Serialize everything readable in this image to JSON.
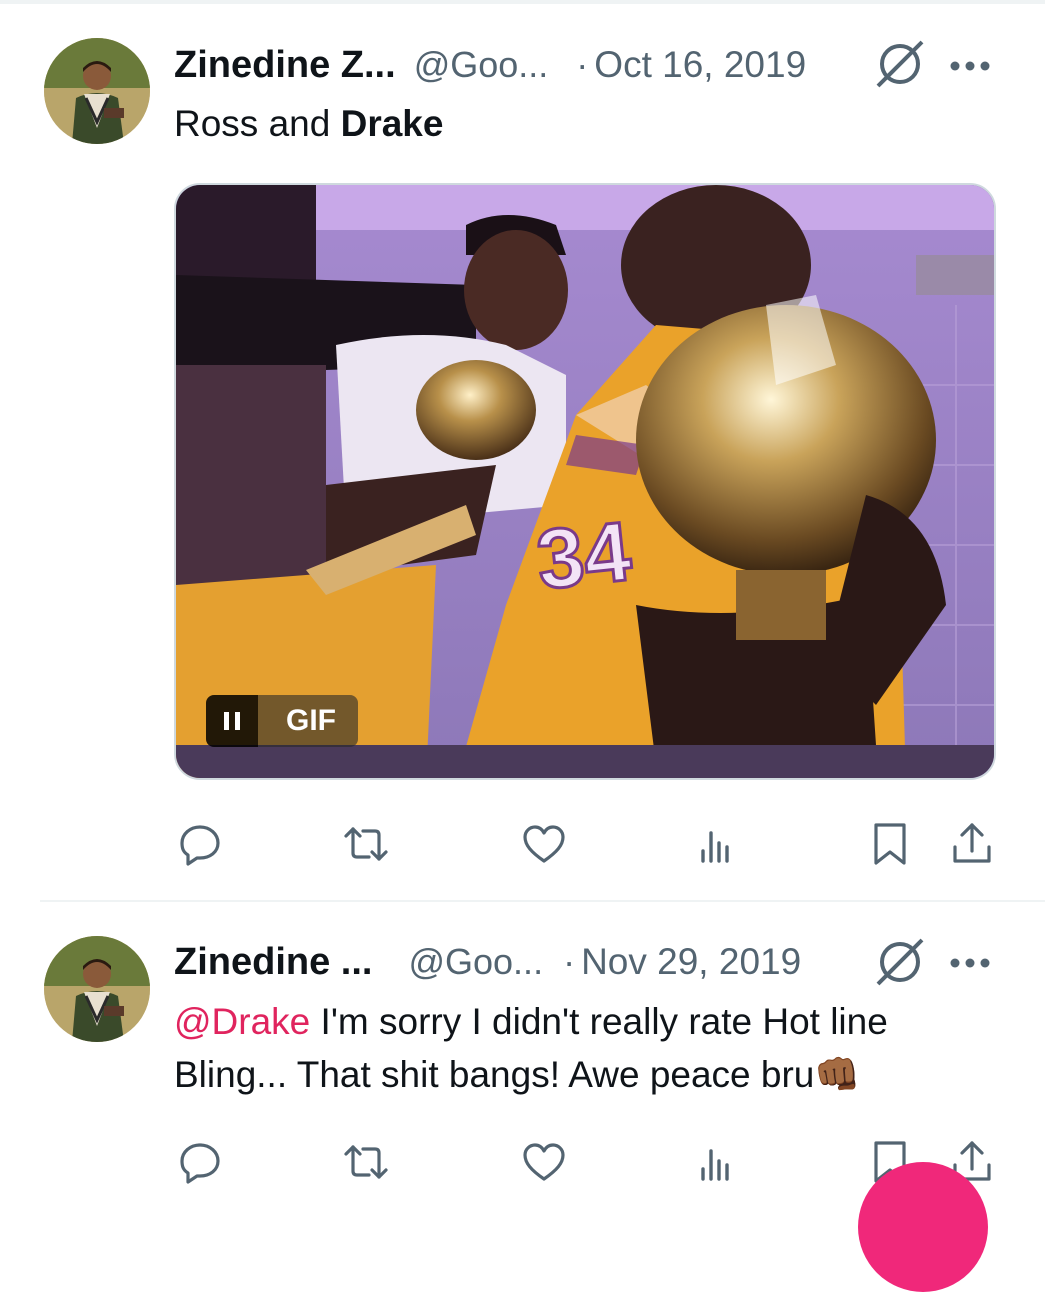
{
  "tweets": [
    {
      "author_name": "Zinedine Z...",
      "handle": "@Goo...",
      "separator": "·",
      "date": "Oct 16, 2019",
      "text_before": "Ross and ",
      "text_bold": "Drake",
      "media": {
        "type": "gif",
        "badge_label": "GIF",
        "jersey_number": "34"
      }
    },
    {
      "author_name": "Zinedine ...",
      "handle": "@Goo...",
      "separator": "·",
      "date": "Nov 29, 2019",
      "mention": "@Drake",
      "text": " I'm sorry I didn't really rate Hot line Bling... That shit bangs! Awe peace bru",
      "emoji": "👊🏾"
    }
  ],
  "actions": [
    "reply-icon",
    "retweet-icon",
    "like-icon",
    "views-icon",
    "bookmark-icon",
    "share-icon"
  ],
  "colors": {
    "text": "#0f1419",
    "secondary": "#536471",
    "mention": "#e0245e",
    "icon": "#536471",
    "fab": "#f0287a"
  }
}
